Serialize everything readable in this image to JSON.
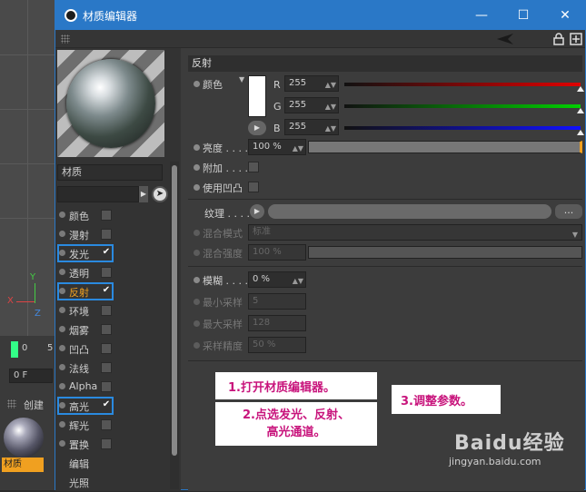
{
  "window": {
    "title": "材质编辑器",
    "minimize": "—",
    "maximize": "☐",
    "close": "✕"
  },
  "material": {
    "name_label": "材质"
  },
  "channels": [
    {
      "label": "颜色",
      "checked": false,
      "active": false,
      "highlight": false
    },
    {
      "label": "漫射",
      "checked": false,
      "active": false,
      "highlight": false
    },
    {
      "label": "发光",
      "checked": true,
      "active": false,
      "highlight": true
    },
    {
      "label": "透明",
      "checked": false,
      "active": false,
      "highlight": false
    },
    {
      "label": "反射",
      "checked": true,
      "active": true,
      "highlight": true
    },
    {
      "label": "环境",
      "checked": false,
      "active": false,
      "highlight": false
    },
    {
      "label": "烟雾",
      "checked": false,
      "active": false,
      "highlight": false
    },
    {
      "label": "凹凸",
      "checked": false,
      "active": false,
      "highlight": false
    },
    {
      "label": "法线",
      "checked": false,
      "active": false,
      "highlight": false
    },
    {
      "label": "Alpha",
      "checked": false,
      "active": false,
      "highlight": false
    },
    {
      "label": "高光",
      "checked": true,
      "active": false,
      "highlight": true
    },
    {
      "label": "辉光",
      "checked": false,
      "active": false,
      "highlight": false
    },
    {
      "label": "置换",
      "checked": false,
      "active": false,
      "highlight": false
    },
    {
      "label": "编辑",
      "checked": null,
      "active": false,
      "highlight": false
    },
    {
      "label": "光照",
      "checked": null,
      "active": false,
      "highlight": false
    }
  ],
  "check_mark": "✔",
  "section": {
    "title": "反射"
  },
  "color": {
    "label": "颜色",
    "r_label": "R",
    "r_value": "255",
    "g_label": "G",
    "g_value": "255",
    "b_label": "B",
    "b_value": "255",
    "swatch": "#ffffff"
  },
  "brightness": {
    "label": "亮度 . . . .",
    "value": "100 %",
    "fill": 1.0
  },
  "additive": {
    "label": "附加 . . . ."
  },
  "use_bump": {
    "label": "使用凹凸"
  },
  "texture": {
    "label": "纹理 . . . .",
    "more_button": "..."
  },
  "blend_mode": {
    "label": "混合模式",
    "value": "标准"
  },
  "blend_strength": {
    "label": "混合强度",
    "value": "100 %"
  },
  "blur": {
    "label": "模糊 . . . .",
    "value": "0 %"
  },
  "min_samples": {
    "label": "最小采样",
    "value": "5"
  },
  "max_samples": {
    "label": "最大采样",
    "value": "128"
  },
  "sample_accuracy": {
    "label": "采样精度",
    "value": "50 %"
  },
  "notes": {
    "step1": "1.打开材质编辑器。",
    "step2_line1": "2.点选发光、反射、",
    "step2_line2": "高光通道。",
    "step3": "3.调整参数。"
  },
  "watermark": {
    "brand": "Baidu经验",
    "url": "jingyan.baidu.com"
  },
  "background": {
    "axis_y": "Y",
    "axis_x": "X",
    "axis_z": "Z",
    "frame_field": "0 F",
    "timeline_value": "0",
    "timeline_value2": "5",
    "create_label": "创建",
    "thumb_label": "材质"
  },
  "colors": {
    "accent": "#2a78c7",
    "active_channel": "#f0a020",
    "highlight_box": "#2a8ae0",
    "note_text": "#c8147c"
  }
}
